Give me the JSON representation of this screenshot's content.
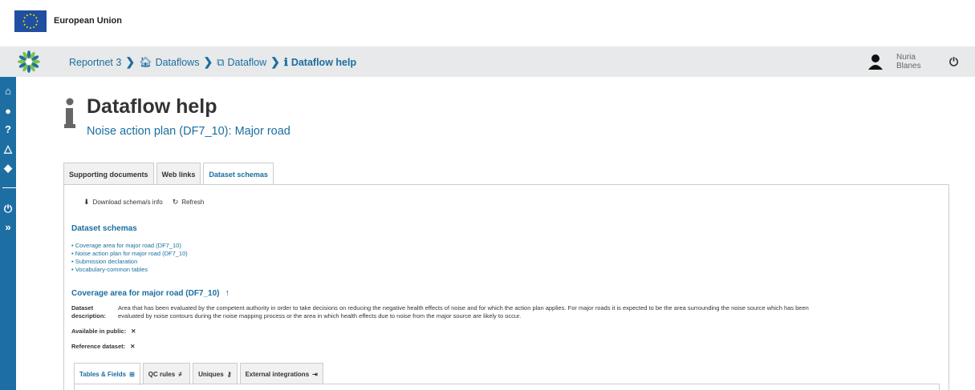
{
  "eu_header": {
    "title": "European Union"
  },
  "breadcrumb": {
    "items": [
      {
        "label": "Reportnet 3",
        "icon": ""
      },
      {
        "label": "Dataflows",
        "icon": "home-icon"
      },
      {
        "label": "Dataflow",
        "icon": "clone-icon"
      },
      {
        "label": "Dataflow help",
        "icon": "info-icon"
      }
    ],
    "separator": ">"
  },
  "user": {
    "first_name": "Nuria",
    "last_name": "Blanes"
  },
  "sidebar": {
    "icons": [
      "home-icon",
      "user-circle-icon",
      "help-circle-icon",
      "bell-icon",
      "comment-icon",
      "power-icon",
      "expand-icon"
    ]
  },
  "page": {
    "title": "Dataflow help",
    "subtitle": "Noise action plan (DF7_10): Major road"
  },
  "tabs": [
    {
      "label": "Supporting documents"
    },
    {
      "label": "Web links"
    },
    {
      "label": "Dataset schemas"
    }
  ],
  "toolbar": {
    "download_label": "Download schema/s info",
    "refresh_label": "Refresh"
  },
  "schemas": {
    "section_title": "Dataset schemas",
    "items": [
      "• Coverage area for major road (DF7_10)",
      "• Noise action plan for major road (DF7_10)",
      "• Submission declaration",
      "• Vocabulary-common tables"
    ]
  },
  "coverage": {
    "title": "Coverage area for major road (DF7_10)",
    "description_label_1": "Dataset",
    "description_label_2": "description:",
    "description_line_1": "Area that has been evaluated by the competent authority in order to take decisions on reducing the negative health effects of noise and for which the action plan applies. For major roads it is expected to be the area surrounding the noise source which has been",
    "description_line_2": "evaluated by noise contours during the noise mapping process or the area in which health effects due to noise from the major source are likely to occur.",
    "available_label": "Available in public:",
    "available_value": "✕",
    "reference_label": "Reference dataset:",
    "reference_value": "✕"
  },
  "subtabs": [
    {
      "label": "Tables & Fields",
      "icon": "⊞"
    },
    {
      "label": "QC rules",
      "icon": "≢"
    },
    {
      "label": "Uniques",
      "icon": "🔑"
    },
    {
      "label": "External integrations",
      "icon": "⇥"
    }
  ],
  "colors": {
    "primary": "#1d6fa3",
    "link": "#1a6ea0",
    "topbar": "#e8e9ea"
  }
}
